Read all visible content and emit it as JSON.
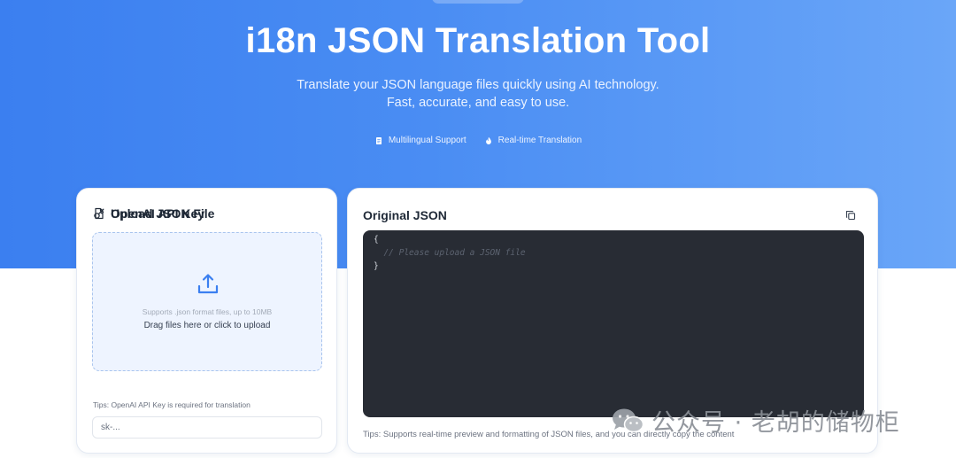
{
  "hero": {
    "title": "i18n JSON Translation Tool",
    "subtitle": "Translate your JSON language files quickly using AI technology. Fast, accurate, and easy to use.",
    "features": [
      {
        "label": "Multilingual Support",
        "icon": "document-icon"
      },
      {
        "label": "Real-time Translation",
        "icon": "flame-icon"
      }
    ]
  },
  "upload": {
    "title": "Upload JSON File",
    "hint": "Supports .json format files, up to 10MB",
    "cta": "Drag files here or click to upload"
  },
  "api": {
    "title": "OpenAI API Key",
    "tip": "Tips: OpenAI API Key is required for translation",
    "placeholder": "sk-..."
  },
  "original": {
    "title": "Original JSON",
    "code": [
      "{",
      "  // Please upload a JSON file",
      "}"
    ],
    "tip": "Tips: Supports real-time preview and formatting of JSON files, and you can directly copy the content"
  },
  "watermark": {
    "text": "公众号 · 老胡的储物柜"
  },
  "colors": {
    "accent": "#3b7ff0",
    "editor_bg": "#282c34"
  }
}
